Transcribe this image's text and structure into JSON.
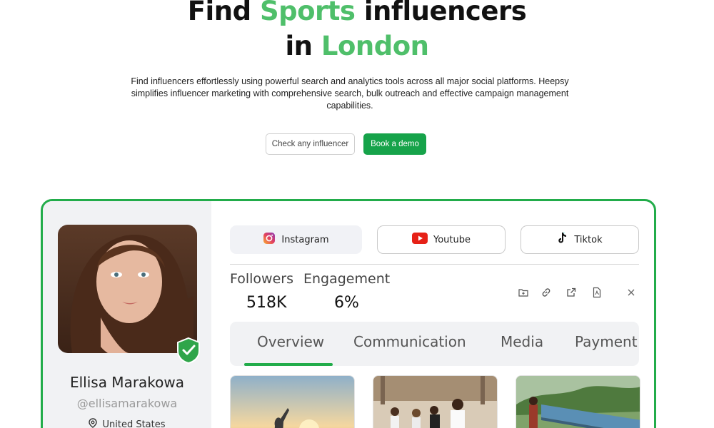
{
  "hero": {
    "title_line1_a": "Find ",
    "title_line1_accent": "Sports",
    "title_line1_b": " influencers",
    "title_line2_a": "in ",
    "title_line2_accent": "London",
    "description": "Find influencers effortlessly using powerful search and analytics tools across all major social platforms. Heepsy simplifies influencer marketing with comprehensive search, bulk outreach and effective campaign management capabilities.",
    "btn_check": "Check any influencer",
    "btn_demo": "Book a demo"
  },
  "profile": {
    "name": "Ellisa Marakowa",
    "handle": "@ellisamarakowa",
    "location": "United States"
  },
  "platforms": [
    "Instagram",
    "Youtube",
    "Tiktok"
  ],
  "stats": {
    "followers_label": "Followers",
    "followers_value": "518K",
    "engagement_label": "Engagement",
    "engagement_value": "6%"
  },
  "subtabs": [
    "Overview",
    "Communication",
    "Media",
    "Payment"
  ],
  "colors": {
    "accent": "#4fbf6a",
    "primary": "#16a34a",
    "border": "#22ac4a",
    "youtube": "#e62117"
  }
}
